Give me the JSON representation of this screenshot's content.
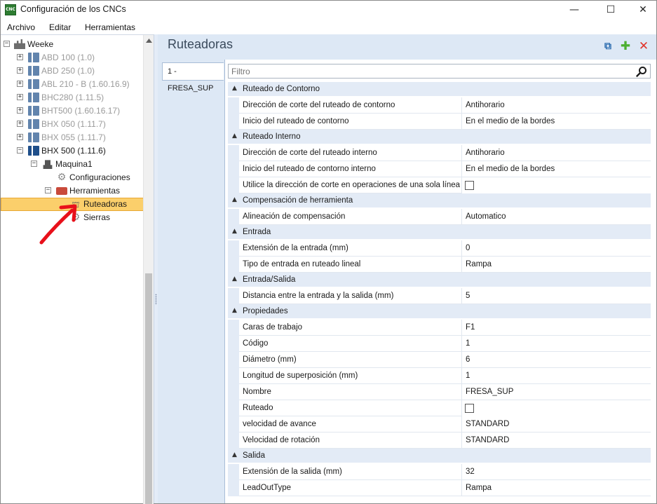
{
  "window": {
    "title": "Configuración de los CNCs",
    "app_icon_text": "CNC",
    "controls": {
      "minimize": "—",
      "maximize": "☐",
      "close": "✕"
    }
  },
  "menu": [
    "Archivo",
    "Editar",
    "Herramientas"
  ],
  "tree": {
    "root": "Weeke",
    "machines": [
      {
        "label": "ABD 100 (1.0)",
        "enabled": false
      },
      {
        "label": "ABD 250 (1.0)",
        "enabled": false
      },
      {
        "label": "ABL 210 - B (1.60.16.9)",
        "enabled": false
      },
      {
        "label": "BHC280 (1.11.5)",
        "enabled": false
      },
      {
        "label": "BHT500 (1.60.16.17)",
        "enabled": false
      },
      {
        "label": "BHX 050 (1.11.7)",
        "enabled": false
      },
      {
        "label": "BHX 055 (1.11.7)",
        "enabled": false
      },
      {
        "label": "BHX 500 (1.11.6)",
        "enabled": true
      }
    ],
    "machine_node": "Maquina1",
    "config_node": "Configuraciones",
    "tools_node": "Herramientas",
    "routers_node": "Ruteadoras",
    "saws_node": "Sierras"
  },
  "panel": {
    "title": "Ruteadoras",
    "tab": "1 - FRESA_SUP",
    "filter_placeholder": "Filtro",
    "icons": {
      "copy": "copy-icon",
      "add": "add-icon",
      "delete": "delete-icon"
    }
  },
  "grid": {
    "categories": [
      {
        "label": "Ruteado de Contorno",
        "props": [
          {
            "name": "Dirección de corte del ruteado de contorno",
            "value": "Antihorario"
          },
          {
            "name": "Inicio del ruteado de contorno",
            "value": "En el medio de la bordes"
          }
        ]
      },
      {
        "label": "Ruteado Interno",
        "props": [
          {
            "name": "Dirección de corte del ruteado interno",
            "value": "Antihorario"
          },
          {
            "name": "Inicio del ruteado de contorno interno",
            "value": "En el medio de la bordes"
          },
          {
            "name": "Utilice la dirección de corte en operaciones de una sola línea",
            "value": "",
            "checkbox": true
          }
        ]
      },
      {
        "label": "Compensación de herramienta",
        "props": [
          {
            "name": "Alineación de compensación",
            "value": "Automatico"
          }
        ]
      },
      {
        "label": "Entrada",
        "props": [
          {
            "name": "Extensión de la entrada (mm)",
            "value": "0"
          },
          {
            "name": "Tipo de entrada en ruteado lineal",
            "value": "Rampa"
          }
        ]
      },
      {
        "label": "Entrada/Salida",
        "props": [
          {
            "name": "Distancia entre la entrada y la salida (mm)",
            "value": "5"
          }
        ]
      },
      {
        "label": "Propiedades",
        "props": [
          {
            "name": "Caras de trabajo",
            "value": "F1"
          },
          {
            "name": "Código",
            "value": "1"
          },
          {
            "name": "Diámetro (mm)",
            "value": "6"
          },
          {
            "name": "Longitud de superposición (mm)",
            "value": "1"
          },
          {
            "name": "Nombre",
            "value": "FRESA_SUP"
          },
          {
            "name": "Ruteado",
            "value": "",
            "checkbox": true
          },
          {
            "name": "velocidad de avance",
            "value": "STANDARD"
          },
          {
            "name": "Velocidad de rotación",
            "value": "STANDARD"
          }
        ]
      },
      {
        "label": "Salida",
        "props": [
          {
            "name": "Extensión de la salida (mm)",
            "value": "32"
          },
          {
            "name": "LeadOutType",
            "value": "Rampa"
          }
        ]
      }
    ]
  }
}
